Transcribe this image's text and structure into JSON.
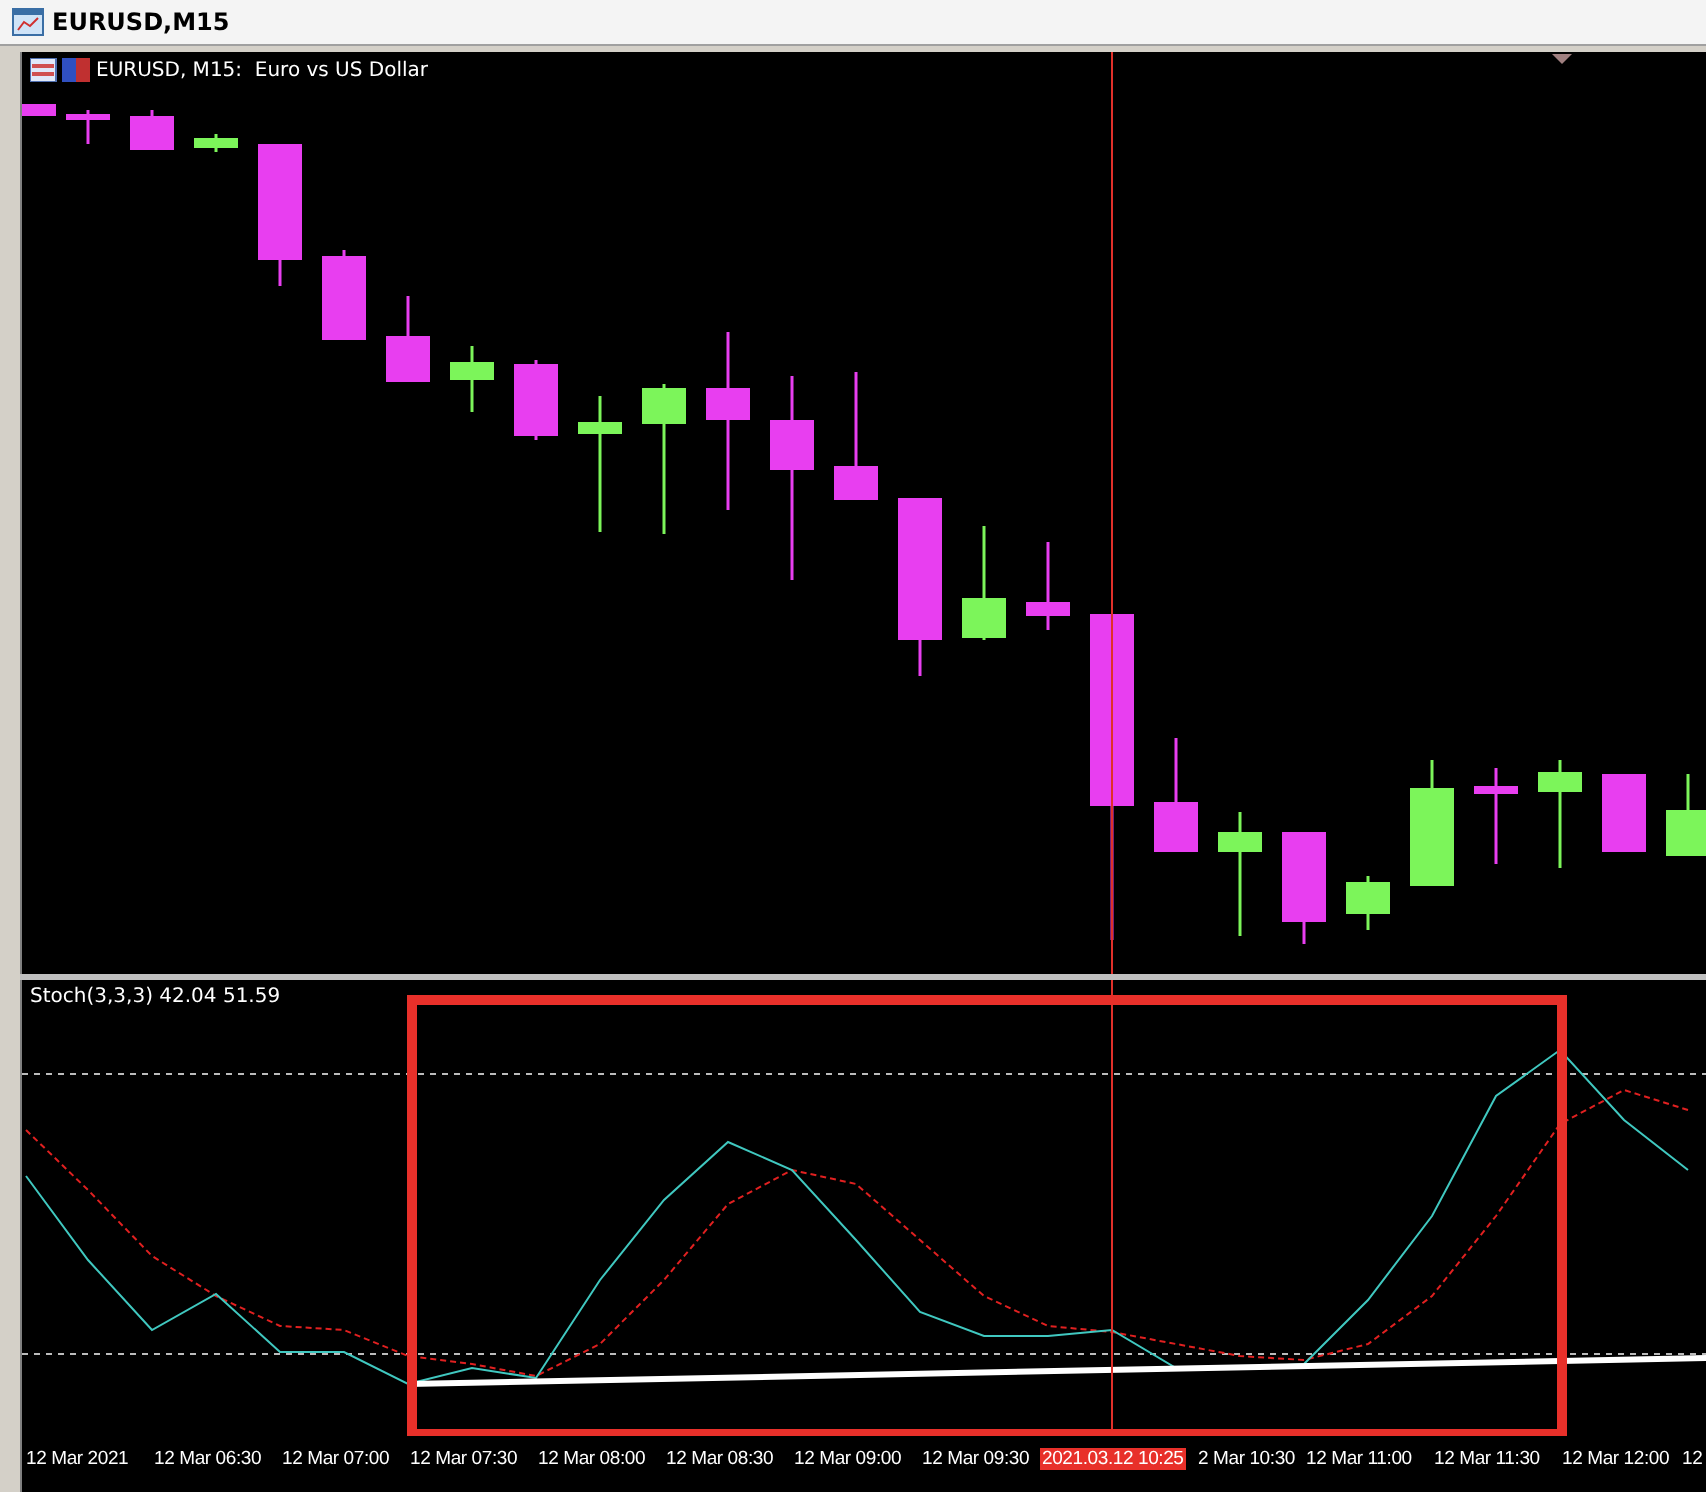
{
  "window": {
    "title": "EURUSD,M15"
  },
  "chart": {
    "header": "EURUSD, M15:  Euro vs US Dollar"
  },
  "indicator": {
    "label": "Stoch(3,3,3) 42.04 51.59"
  },
  "time_axis": {
    "labels": [
      "12 Mar 2021",
      "12 Mar 06:30",
      "12 Mar 07:00",
      "12 Mar 07:30",
      "12 Mar 08:00",
      "12 Mar 08:30",
      "12 Mar 09:00",
      "12 Mar 09:30",
      "2 Mar 10:30",
      "12 Mar 11:00",
      "12 Mar 11:30",
      "12 Mar 12:00",
      "12"
    ],
    "crosshair_label": "2021.03.12 10:25"
  }
}
